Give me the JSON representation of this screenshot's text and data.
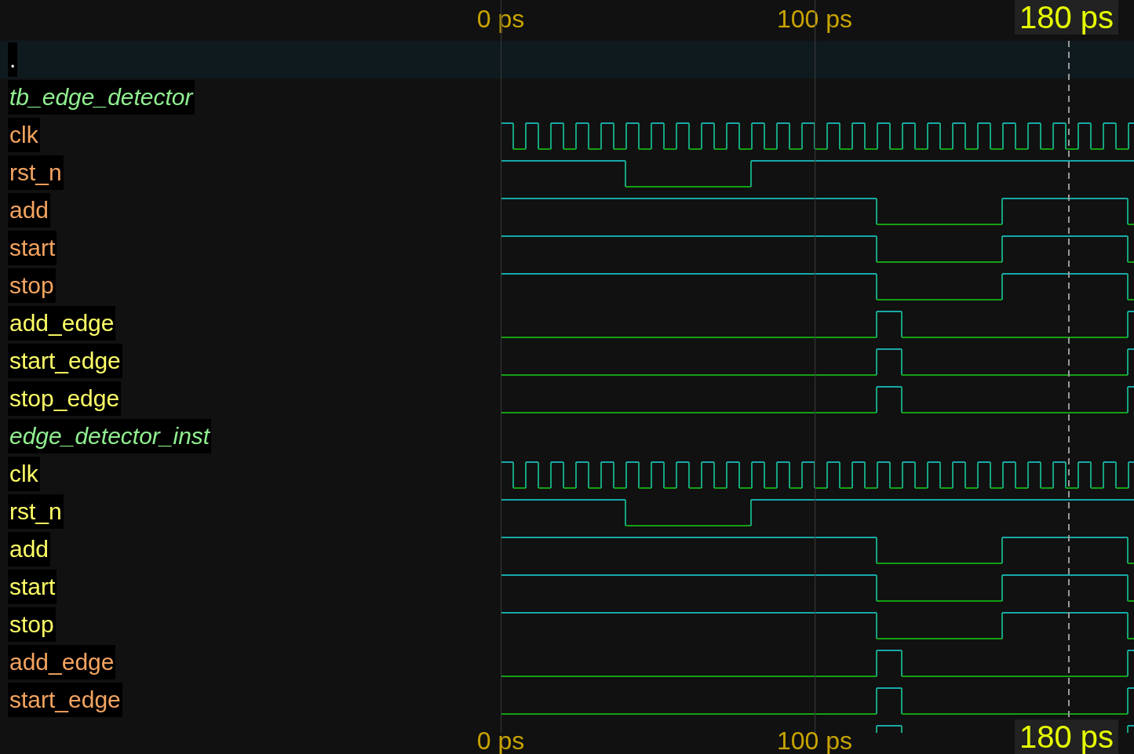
{
  "ruler_top": {
    "ticks": [
      "0 ps",
      "100 ps"
    ],
    "cursor_label": "180 ps"
  },
  "root_row": {
    "label": ".",
    "selected": true
  },
  "scopes": [
    {
      "name": "tb_edge_detector",
      "signals": [
        {
          "name": "clk",
          "color": "#f4a460"
        },
        {
          "name": "rst_n",
          "color": "#f4a460"
        },
        {
          "name": "add",
          "color": "#f4a460"
        },
        {
          "name": "start",
          "color": "#f4a460"
        },
        {
          "name": "stop",
          "color": "#f4a460"
        },
        {
          "name": "add_edge",
          "color": "#ffff66"
        },
        {
          "name": "start_edge",
          "color": "#ffff66"
        },
        {
          "name": "stop_edge",
          "color": "#ffff66"
        }
      ]
    },
    {
      "name": "edge_detector_inst",
      "signals": [
        {
          "name": "clk",
          "color": "#ffff66"
        },
        {
          "name": "rst_n",
          "color": "#ffff66"
        },
        {
          "name": "add",
          "color": "#ffff66"
        },
        {
          "name": "start",
          "color": "#ffff66"
        },
        {
          "name": "stop",
          "color": "#ffff66"
        },
        {
          "name": "add_edge",
          "color": "#f4a460"
        },
        {
          "name": "start_edge",
          "color": "#f4a460"
        }
      ]
    }
  ],
  "ruler_bottom": {
    "ticks": [
      "0 ps",
      "100 ps"
    ],
    "cursor_label": "180 ps"
  }
}
